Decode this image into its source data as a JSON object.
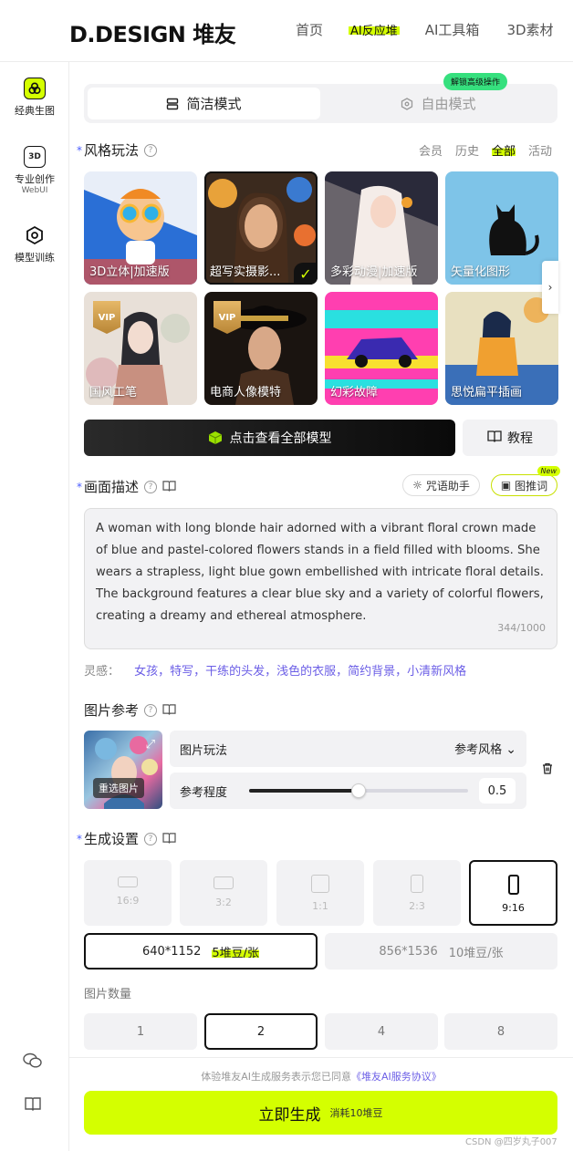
{
  "header": {
    "logo": "D.DESIGN 堆友",
    "nav": [
      "首页",
      "AI反应堆",
      "AI工具箱",
      "3D素材"
    ],
    "active_nav": "AI反应堆"
  },
  "sidebar": {
    "items": [
      {
        "label": "经典生图",
        "sub": ""
      },
      {
        "label": "专业创作",
        "sub": "WebUI"
      },
      {
        "label": "模型训练",
        "sub": ""
      }
    ],
    "icon_texts": [
      "3D"
    ]
  },
  "mode": {
    "simple": "简洁模式",
    "free": "自由模式",
    "badge": "解锁高级操作"
  },
  "style": {
    "title": "风格玩法",
    "filters": [
      "会员",
      "历史",
      "全部",
      "活动"
    ],
    "active_filter": "全部",
    "cards": [
      {
        "label": "3D立体|加速版",
        "colors": [
          "#2a6fd6",
          "#e74c3c",
          "#f7b733"
        ],
        "selected": false,
        "vip": false
      },
      {
        "label": "超写实摄影...",
        "colors": [
          "#3b2a1e",
          "#c9804a",
          "#e8a23a"
        ],
        "selected": true,
        "vip": false
      },
      {
        "label": "多彩动漫|加速版",
        "colors": [
          "#2a2a3a",
          "#d8c2b8",
          "#f0e6e0"
        ],
        "selected": false,
        "vip": false
      },
      {
        "label": "矢量化图形",
        "colors": [
          "#7ec4e8",
          "#a8d6f0",
          "#5ab0de"
        ],
        "selected": false,
        "vip": false
      },
      {
        "label": "国风工笔",
        "colors": [
          "#e8e0d8",
          "#d8a0a8",
          "#c89080"
        ],
        "selected": false,
        "vip": true
      },
      {
        "label": "电商人像模特",
        "colors": [
          "#1a1410",
          "#4a3020",
          "#c8a040"
        ],
        "selected": false,
        "vip": true
      },
      {
        "label": "幻彩故障",
        "colors": [
          "#ff3fb0",
          "#2ae0e0",
          "#f8e030"
        ],
        "selected": false,
        "vip": false
      },
      {
        "label": "思悦扁平插画",
        "colors": [
          "#3a6fb8",
          "#f0a030",
          "#e8e0c0"
        ],
        "selected": false,
        "vip": false
      }
    ],
    "vip_text": "VIP"
  },
  "actions": {
    "view_all": "点击查看全部模型",
    "tutorial": "教程"
  },
  "prompt": {
    "title": "画面描述",
    "helper": "咒语助手",
    "image_prompt": "图推词",
    "new_tag": "New",
    "text": "A woman with long blonde hair adorned with a vibrant floral crown made of blue and pastel-colored flowers stands in a field filled with blooms. She wears a strapless, light blue gown embellished with intricate floral details. The background features a clear blue sky and a variety of colorful flowers, creating a dreamy and ethereal atmosphere.",
    "counter": "344/1000"
  },
  "inspiration": {
    "label": "灵感：",
    "tags": "女孩，特写，干练的头发，浅色的衣服，简约背景，小清新风格"
  },
  "reference": {
    "title": "图片参考",
    "reselect": "重选图片",
    "play_label": "图片玩法",
    "play_value": "参考风格",
    "degree_label": "参考程度",
    "degree_value": "0.5",
    "degree_fraction": 0.5
  },
  "settings": {
    "title": "生成设置",
    "ratios": [
      "16:9",
      "3:2",
      "1:1",
      "2:3",
      "9:16"
    ],
    "selected_ratio": "9:16",
    "resolutions": [
      {
        "size": "640*1152",
        "cost": "5堆豆/张",
        "selected": true
      },
      {
        "size": "856*1536",
        "cost": "10堆豆/张",
        "selected": false
      }
    ],
    "count_label": "图片数量",
    "counts": [
      "1",
      "2",
      "4",
      "8"
    ],
    "selected_count": "2"
  },
  "footer": {
    "agree_text": "体验堆友AI生成服务表示您已同意",
    "agree_link": "《堆友AI服务协议》",
    "generate": "立即生成",
    "cost": "消耗10堆豆",
    "watermark": "CSDN @四岁丸子007"
  },
  "colors": {
    "accent": "#d4ff00",
    "link": "#6b5ee6",
    "required": "#4a5cff"
  }
}
